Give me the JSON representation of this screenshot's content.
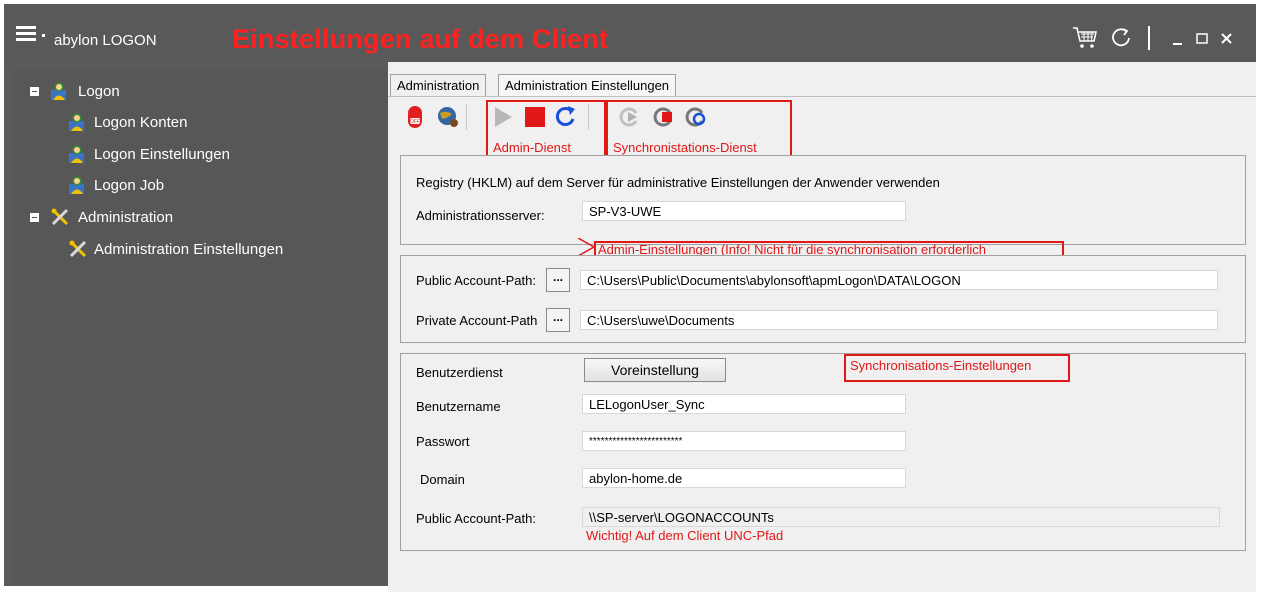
{
  "titlebar": {
    "app_name": "abylon LOGON",
    "annotation": "Einstellungen auf dem Client",
    "icons": [
      "menu-icon",
      "cart-icon",
      "refresh-icon",
      "minimize-icon",
      "maximize-icon",
      "close-icon"
    ]
  },
  "sidebar": {
    "items": [
      {
        "label": "Logon",
        "level": 0,
        "icon": "user-icon"
      },
      {
        "label": "Logon Konten",
        "level": 1,
        "icon": "user-icon"
      },
      {
        "label": "Logon Einstellungen",
        "level": 1,
        "icon": "user-icon"
      },
      {
        "label": "Logon Job",
        "level": 1,
        "icon": "user-icon"
      },
      {
        "label": "Administration",
        "level": 0,
        "icon": "tools-icon"
      },
      {
        "label": "Administration Einstellungen",
        "level": 1,
        "icon": "tools-icon"
      }
    ]
  },
  "tabs": [
    {
      "label": "Administration",
      "active": true
    },
    {
      "label": "Administration Einstellungen",
      "active": false
    }
  ],
  "toolbar": {
    "icons": [
      "power-off-icon",
      "network-globe-icon",
      "play-icon",
      "stop-icon",
      "restart-icon",
      "sync-play-icon",
      "sync-stop-icon",
      "sync-restart-icon"
    ],
    "annot_admin": "Admin-Dienst",
    "annot_sync": "Synchronistations-Dienst"
  },
  "registry_group": {
    "description": "Registry (HKLM) auf dem Server für administrative Einstellungen der Anwender verwenden",
    "server_label": "Administrationsserver:",
    "server_value": "SP-V3-UWE"
  },
  "admin_annotation": "Admin-Einstellungen (Info! Nicht für die synchronisation erforderlich",
  "paths_group": {
    "public_label": "Public Account-Path:",
    "public_browse": "...",
    "public_value": "C:\\Users\\Public\\Documents\\abylonsoft\\apmLogon\\DATA\\LOGON",
    "private_label": "Private Account-Path",
    "private_browse": "...",
    "private_value": "C:\\Users\\uwe\\Documents"
  },
  "sync_group": {
    "annotation": "Synchronisations-Einstellungen",
    "service_label": "Benutzerdienst",
    "default_button": "Voreinstellung",
    "username_label": "Benutzername",
    "username_value": "LELogonUser_Sync",
    "password_label": "Passwort",
    "password_value": "************************",
    "domain_label": "Domain",
    "domain_value": "abylon-home.de",
    "public_path_label": "Public Account-Path:",
    "public_path_value": "\\\\SP-server\\LOGONACCOUNTs",
    "unc_annotation": "Wichtig! Auf dem Client UNC-Pfad"
  },
  "colors": {
    "titlebar": "#595959",
    "sidebar": "#575757",
    "content": "#f0f0f0",
    "annotation": "#e01818"
  }
}
